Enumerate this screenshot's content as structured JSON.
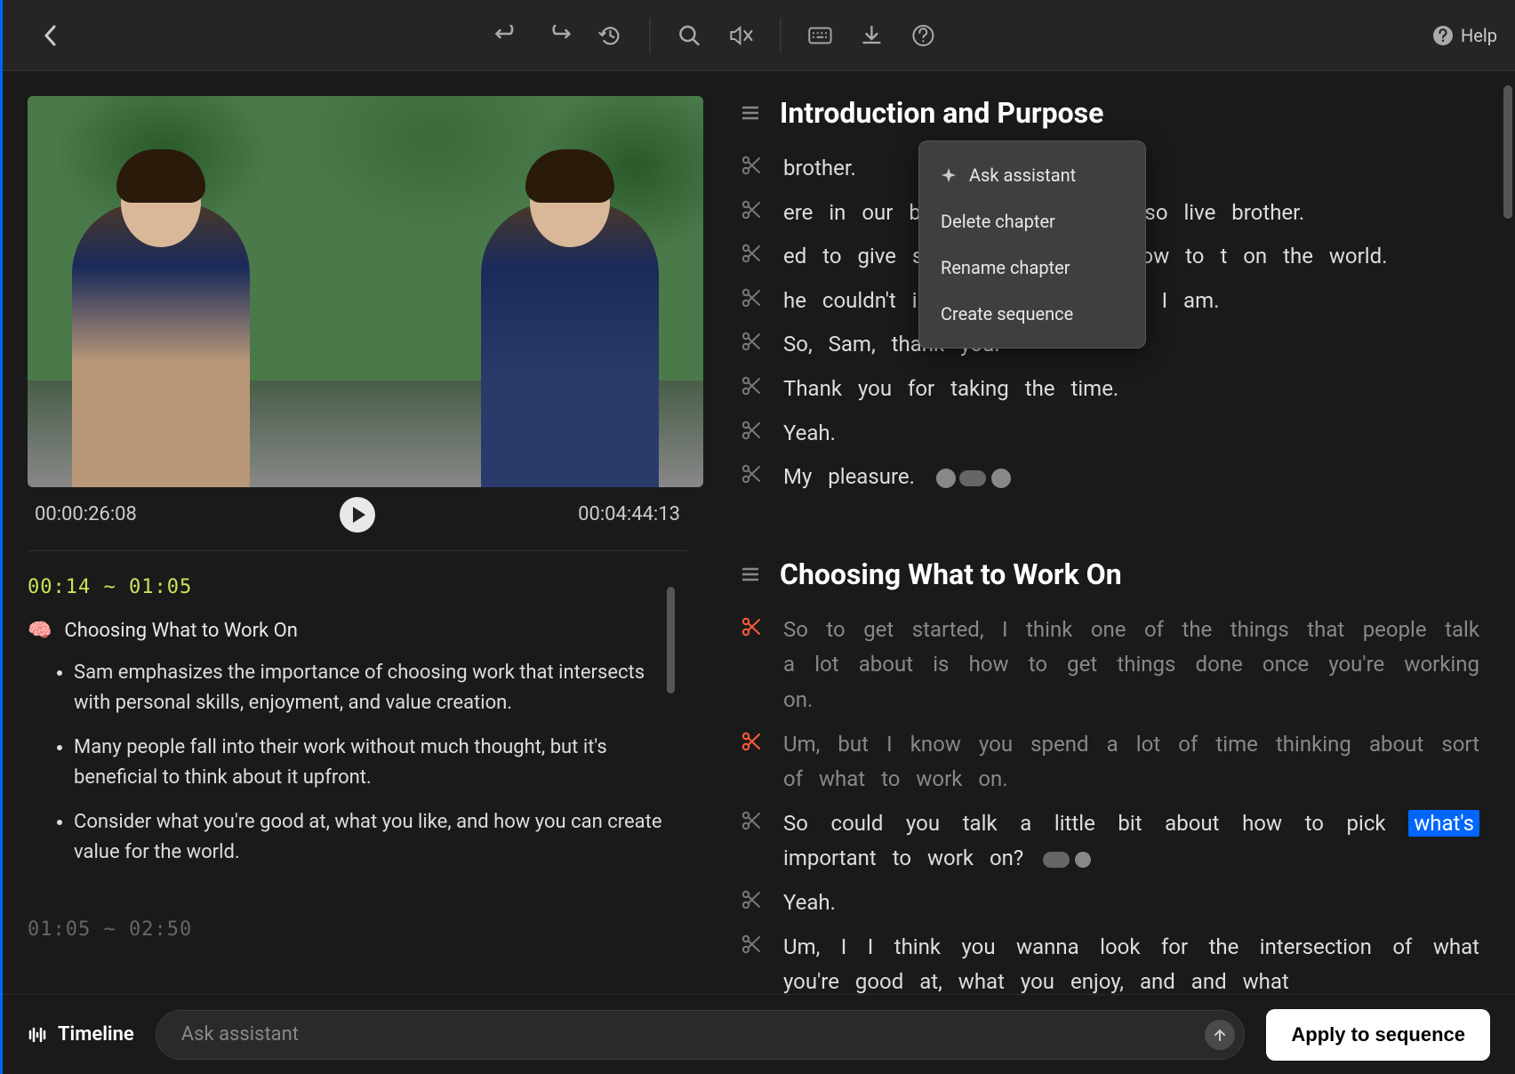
{
  "header": {
    "help_label": "Help"
  },
  "video": {
    "current_time": "00:00:26:08",
    "total_time": "00:04:44:13"
  },
  "notes": [
    {
      "timerange": "00:14 ~ 01:05",
      "emoji": "🧠",
      "title": "Choosing What to Work On",
      "bullets": [
        "Sam emphasizes the importance of choosing work that intersects with personal skills, enjoyment, and value creation.",
        "Many people fall into their work without much thought, but it's beneficial to think about it upfront.",
        "Consider what you're good at, what you like, and how you can create value for the world."
      ]
    },
    {
      "timerange": "01:05 ~ 02:50"
    }
  ],
  "context_menu": {
    "items": [
      {
        "label": "Ask assistant",
        "icon": true
      },
      {
        "label": "Delete chapter"
      },
      {
        "label": "Rename chapter"
      },
      {
        "label": "Create sequence"
      }
    ]
  },
  "chapters": [
    {
      "title": "Introduction and Purpose",
      "lines": [
        {
          "cut": false,
          "text_fragments": [
            " brother."
          ]
        },
        {
          "cut": false,
          "text_fragments": [
            "ere in our backyard where we also live  brother."
          ]
        },
        {
          "cut": false,
          "text_fragments": [
            "ed to give some advice about how to t on the world."
          ]
        },
        {
          "cut": false,
          "text_fragments": [
            "he couldn't interview himself, here I am."
          ]
        },
        {
          "cut": false,
          "text": "So, Sam, thank you."
        },
        {
          "cut": false,
          "text": "Thank you for taking the time."
        },
        {
          "cut": false,
          "text": "Yeah."
        },
        {
          "cut": false,
          "text": "My pleasure.",
          "trailing_dots": true
        }
      ]
    },
    {
      "title": "Choosing What to Work On",
      "lines": [
        {
          "cut": true,
          "dimmed": true,
          "text": "So to get started, I think one of the things that people talk a lot about is how to get things done once you're working on."
        },
        {
          "cut": true,
          "dimmed": true,
          "text": "Um, but I know you spend a lot of time thinking about sort of what to work on."
        },
        {
          "cut": false,
          "text_pre": "So could you talk a little bit about how to pick ",
          "highlight": "what's",
          "text_post": " important to work on?",
          "trailing_pill": true
        },
        {
          "cut": false,
          "text": "Yeah."
        },
        {
          "cut": false,
          "text": "Um, I I think you wanna look for the intersection of what you're good at, what you enjoy, and and what"
        }
      ]
    }
  ],
  "bottom": {
    "timeline_label": "Timeline",
    "assistant_placeholder": "Ask assistant",
    "apply_label": "Apply to sequence"
  }
}
